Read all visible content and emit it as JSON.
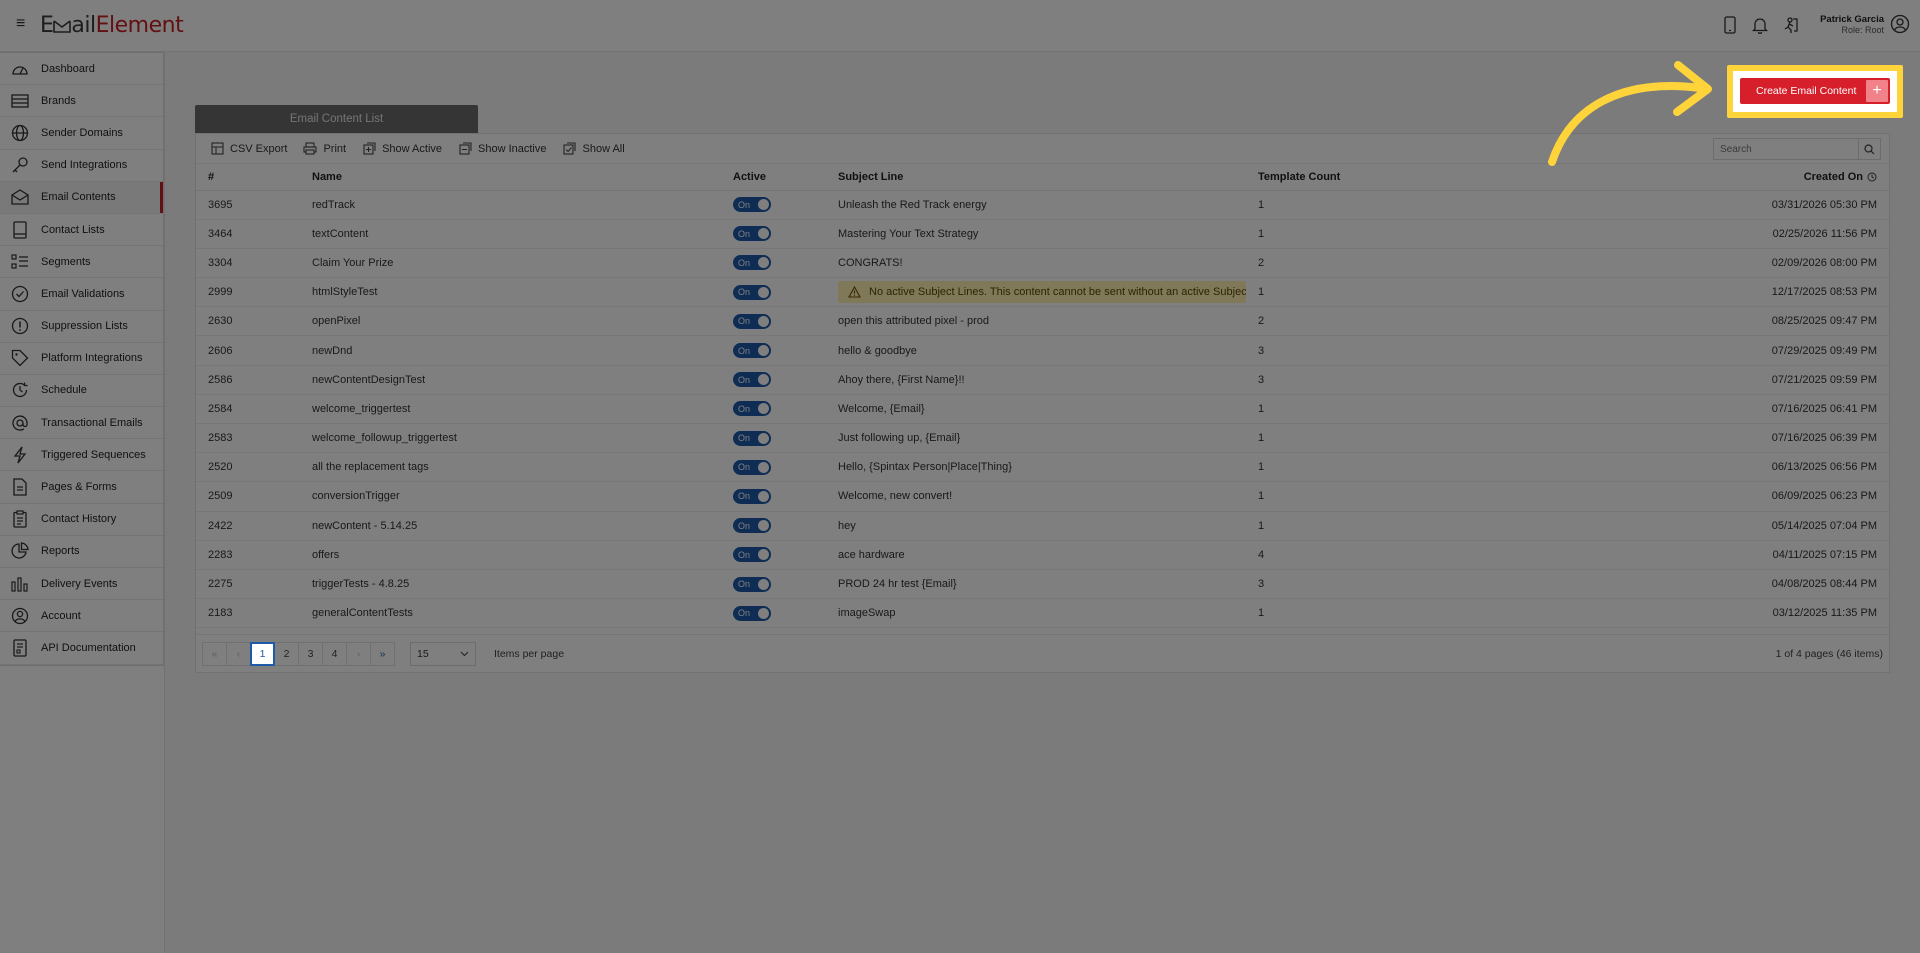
{
  "header": {
    "logo_part1": "E",
    "logo_part2": "ail",
    "logo_part3": "Element",
    "user_name": "Patrick Garcia",
    "user_role": "Role: Root"
  },
  "sidebar": {
    "items": [
      {
        "label": "Dashboard",
        "icon": "dashboard-icon"
      },
      {
        "label": "Brands",
        "icon": "brands-icon"
      },
      {
        "label": "Sender Domains",
        "icon": "globe-icon"
      },
      {
        "label": "Send Integrations",
        "icon": "key-icon"
      },
      {
        "label": "Email Contents",
        "icon": "envelope-icon"
      },
      {
        "label": "Contact Lists",
        "icon": "book-icon"
      },
      {
        "label": "Segments",
        "icon": "segments-icon"
      },
      {
        "label": "Email Validations",
        "icon": "check-circle-icon"
      },
      {
        "label": "Suppression Lists",
        "icon": "exclamation-circle-icon"
      },
      {
        "label": "Platform Integrations",
        "icon": "tag-icon"
      },
      {
        "label": "Schedule",
        "icon": "schedule-icon"
      },
      {
        "label": "Transactional Emails",
        "icon": "at-icon"
      },
      {
        "label": "Triggered Sequences",
        "icon": "lightning-icon"
      },
      {
        "label": "Pages & Forms",
        "icon": "page-icon"
      },
      {
        "label": "Contact History",
        "icon": "clipboard-icon"
      },
      {
        "label": "Reports",
        "icon": "pie-chart-icon"
      },
      {
        "label": "Delivery Events",
        "icon": "bar-chart-icon"
      },
      {
        "label": "Account",
        "icon": "account-icon"
      },
      {
        "label": "API Documentation",
        "icon": "api-doc-icon"
      }
    ]
  },
  "main": {
    "create_button_label": "Create Email Content",
    "create_button_plus": "+",
    "tab_label": "Email Content List",
    "toolbar": {
      "csv": "CSV Export",
      "print": "Print",
      "show_active": "Show Active",
      "show_inactive": "Show Inactive",
      "show_all": "Show All",
      "search_placeholder": "Search"
    },
    "columns": [
      "#",
      "Name",
      "Active",
      "Subject Line",
      "Template Count",
      "Created On"
    ],
    "toggle_label": "On",
    "rows": [
      {
        "id": "3695",
        "name": "redTrack",
        "subject": "Unleash the Red Track energy",
        "count": "1",
        "created": "03/31/2026 05:30 PM"
      },
      {
        "id": "3464",
        "name": "textContent",
        "subject": "Mastering Your Text Strategy",
        "count": "1",
        "created": "02/25/2026 11:56 PM"
      },
      {
        "id": "3304",
        "name": "Claim Your Prize",
        "subject": "CONGRATS!",
        "count": "2",
        "created": "02/09/2026 08:00 PM"
      },
      {
        "id": "2999",
        "name": "htmlStyleTest",
        "subject": "",
        "warning": "No active Subject Lines. This content cannot be sent without an active Subject ...",
        "count": "1",
        "created": "12/17/2025 08:53 PM"
      },
      {
        "id": "2630",
        "name": "openPixel",
        "subject": "open this attributed pixel - prod",
        "count": "2",
        "created": "08/25/2025 09:47 PM"
      },
      {
        "id": "2606",
        "name": "newDnd",
        "subject": "hello & goodbye",
        "count": "3",
        "created": "07/29/2025 09:49 PM"
      },
      {
        "id": "2586",
        "name": "newContentDesignTest",
        "subject": "Ahoy there, {First Name}!!",
        "count": "3",
        "created": "07/21/2025 09:59 PM"
      },
      {
        "id": "2584",
        "name": "welcome_triggertest",
        "subject": "Welcome, {Email}",
        "count": "1",
        "created": "07/16/2025 06:41 PM"
      },
      {
        "id": "2583",
        "name": "welcome_followup_triggertest",
        "subject": "Just following up, {Email}",
        "count": "1",
        "created": "07/16/2025 06:39 PM"
      },
      {
        "id": "2520",
        "name": "all the replacement tags",
        "subject": "Hello, {Spintax Person|Place|Thing}",
        "count": "1",
        "created": "06/13/2025 06:56 PM"
      },
      {
        "id": "2509",
        "name": "conversionTrigger",
        "subject": "Welcome, new convert!",
        "count": "1",
        "created": "06/09/2025 06:23 PM"
      },
      {
        "id": "2422",
        "name": "newContent - 5.14.25",
        "subject": "hey",
        "count": "1",
        "created": "05/14/2025 07:04 PM"
      },
      {
        "id": "2283",
        "name": "offers",
        "subject": "ace hardware",
        "count": "4",
        "created": "04/11/2025 07:15 PM"
      },
      {
        "id": "2275",
        "name": "triggerTests - 4.8.25",
        "subject": "PROD 24 hr test {Email}",
        "count": "3",
        "created": "04/08/2025 08:44 PM"
      },
      {
        "id": "2183",
        "name": "generalContentTests",
        "subject": "imageSwap",
        "count": "1",
        "created": "03/12/2025 11:35 PM"
      }
    ],
    "pager": {
      "first": "«",
      "prev": "‹",
      "pages": [
        "1",
        "2",
        "3",
        "4"
      ],
      "next": "›",
      "last": "»",
      "per_page_value": "15",
      "per_page_label": "Items per page",
      "info": "1 of 4 pages (46 items)"
    }
  },
  "colors": {
    "brand_red": "#c62026",
    "button_red": "#d61f2b",
    "toggle_blue": "#1e5aa8",
    "highlight_yellow": "#ffd43b",
    "warning_bg": "#fff0b3"
  }
}
